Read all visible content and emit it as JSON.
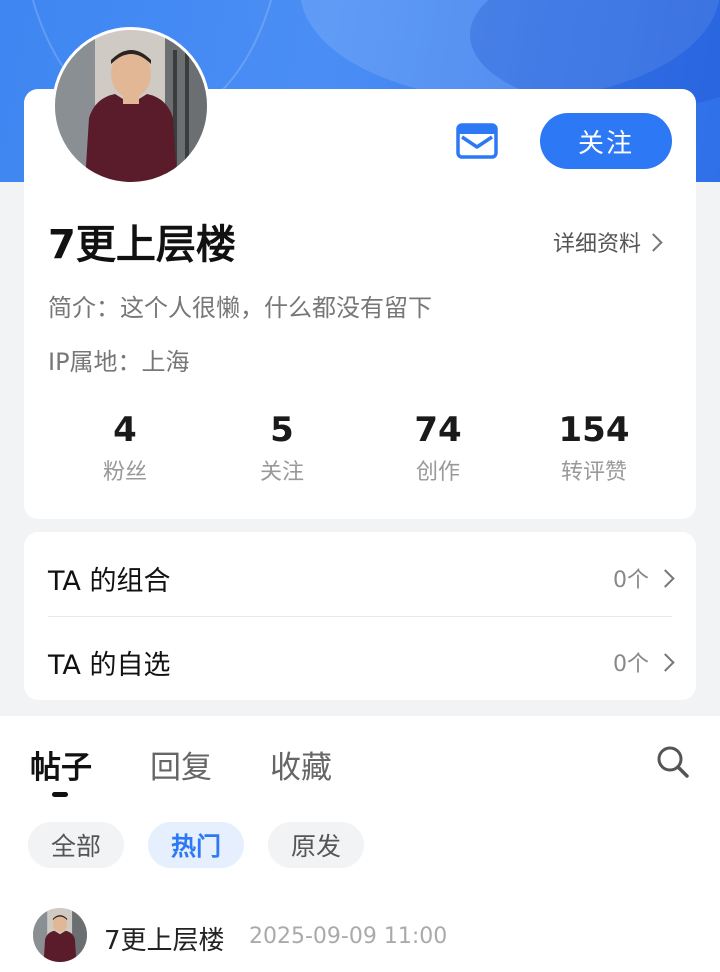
{
  "header": {
    "follow_label": "关注"
  },
  "profile": {
    "username": "7更上层楼",
    "detail_link": "详细资料",
    "bio": "简介：这个人很懒，什么都没有留下",
    "ip_location": "IP属地：上海"
  },
  "stats": [
    {
      "value": "4",
      "label": "粉丝"
    },
    {
      "value": "5",
      "label": "关注"
    },
    {
      "value": "74",
      "label": "创作"
    },
    {
      "value": "154",
      "label": "转评赞"
    }
  ],
  "lists": [
    {
      "title": "TA 的组合",
      "count": "0个"
    },
    {
      "title": "TA 的自选",
      "count": "0个"
    }
  ],
  "tabs": [
    {
      "label": "帖子",
      "active": true
    },
    {
      "label": "回复",
      "active": false
    },
    {
      "label": "收藏",
      "active": false
    }
  ],
  "filters": [
    {
      "label": "全部",
      "active": false
    },
    {
      "label": "热门",
      "active": true
    },
    {
      "label": "原发",
      "active": false
    }
  ],
  "post": {
    "author": "7更上层楼",
    "time": "2025-09-09 11:00"
  },
  "colors": {
    "accent": "#2d78f4",
    "banner": "#4a8ef5"
  },
  "icons": {
    "mail": "mail-icon",
    "search": "search-icon",
    "chevron": "chevron-right-icon"
  }
}
